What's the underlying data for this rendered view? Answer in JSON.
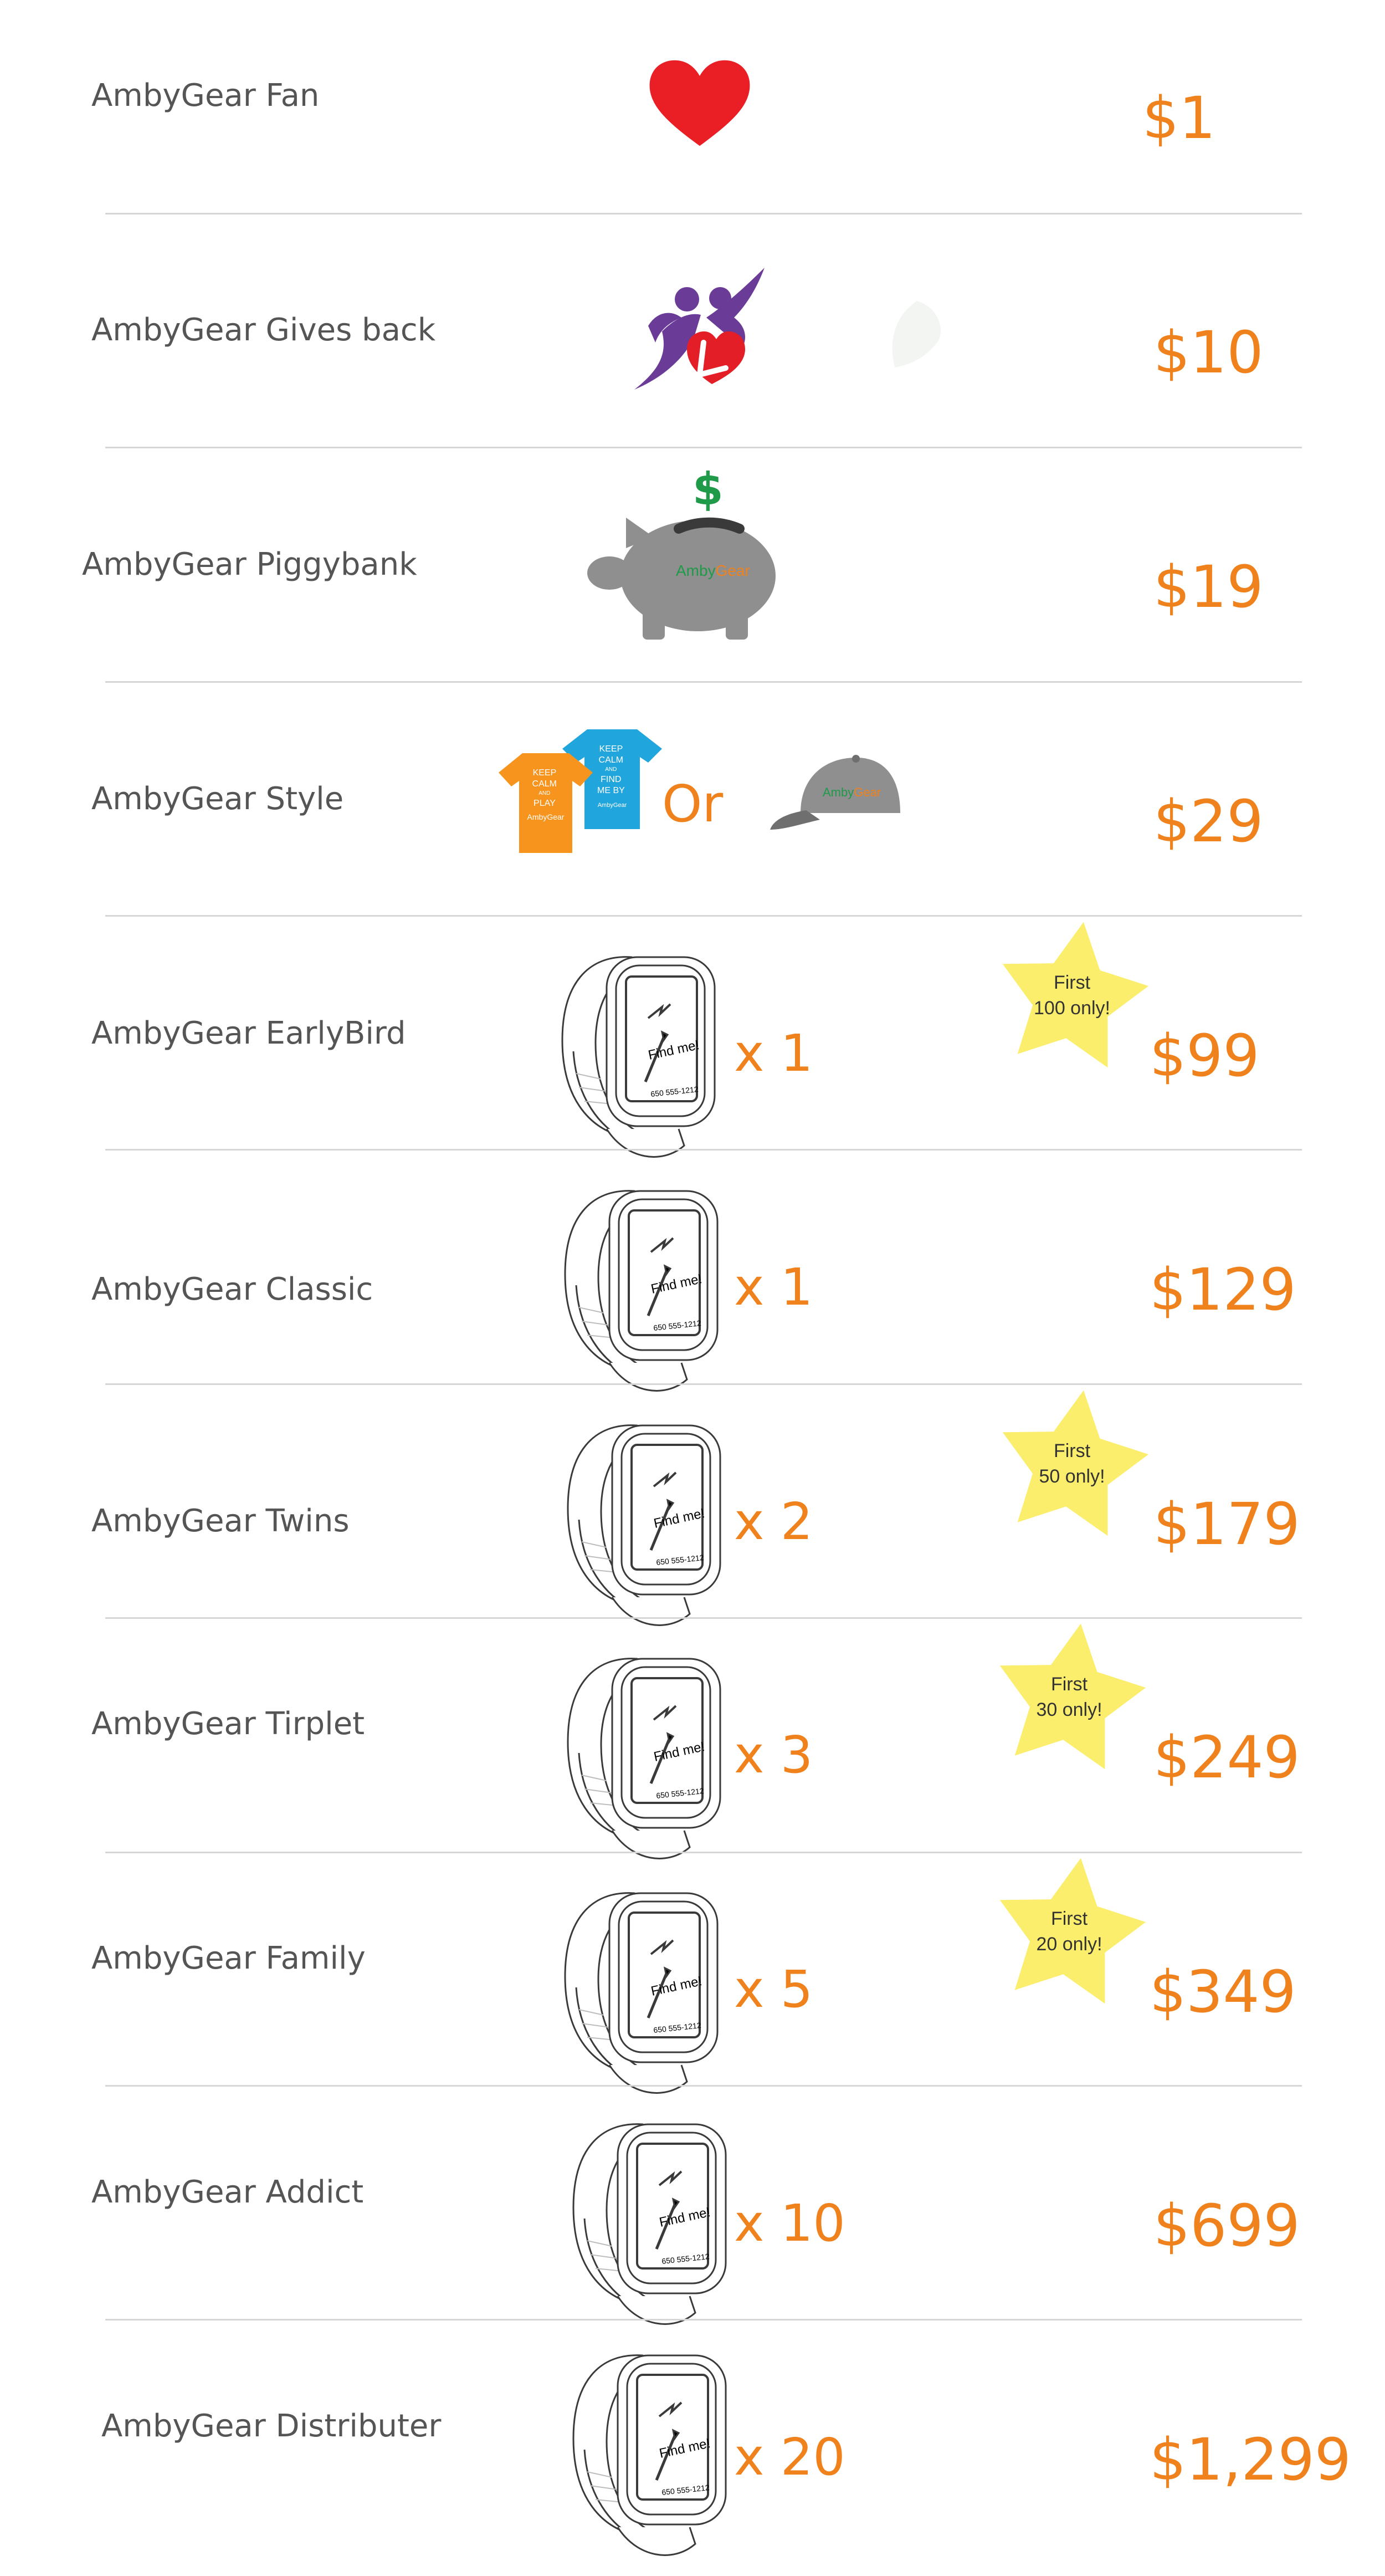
{
  "colors": {
    "accent": "#f0821e",
    "name": "#555555",
    "divider": "#d6d6d6",
    "star": "#fbee6d"
  },
  "watch_display": {
    "text": "Find me!",
    "phone": "650 555-1212"
  },
  "tiers": [
    {
      "name": "AmbyGear Fan",
      "price": "$1",
      "icon": "heart-icon"
    },
    {
      "name": "AmbyGear Gives back",
      "price": "$10",
      "icon": "gives-back-logo"
    },
    {
      "name": "AmbyGear Piggybank",
      "price": "$19",
      "icon": "piggybank-icon",
      "logo": {
        "amby": "Amby",
        "gear": "Gear"
      },
      "coin": "$"
    },
    {
      "name": "AmbyGear Style",
      "price": "$29",
      "icon": "tshirt-and-cap-icon",
      "or": "Or",
      "tee_orange": [
        "KEEP",
        "CALM",
        "AND",
        "PLAY",
        "AmbyGear"
      ],
      "tee_blue": [
        "KEEP",
        "CALM",
        "AND",
        "FIND",
        "ME BY",
        "AmbyGear"
      ],
      "cap_logo": {
        "amby": "Amby",
        "gear": "Gear"
      }
    },
    {
      "name": "AmbyGear EarlyBird",
      "price": "$99",
      "quantity": "x 1",
      "badge": {
        "line1": "First",
        "line2": "100 only!"
      }
    },
    {
      "name": "AmbyGear Classic",
      "price": "$129",
      "quantity": "x 1"
    },
    {
      "name": "AmbyGear Twins",
      "price": "$179",
      "quantity": "x 2",
      "badge": {
        "line1": "First",
        "line2": "50 only!"
      }
    },
    {
      "name": "AmbyGear Tirplet",
      "price": "$249",
      "quantity": "x 3",
      "badge": {
        "line1": "First",
        "line2": "30 only!"
      }
    },
    {
      "name": "AmbyGear Family",
      "price": "$349",
      "quantity": "x 5",
      "badge": {
        "line1": "First",
        "line2": "20 only!"
      }
    },
    {
      "name": "AmbyGear Addict",
      "price": "$699",
      "quantity": "x 10"
    },
    {
      "name": "AmbyGear Distributer",
      "price": "$1,299",
      "quantity": "x 20"
    }
  ]
}
